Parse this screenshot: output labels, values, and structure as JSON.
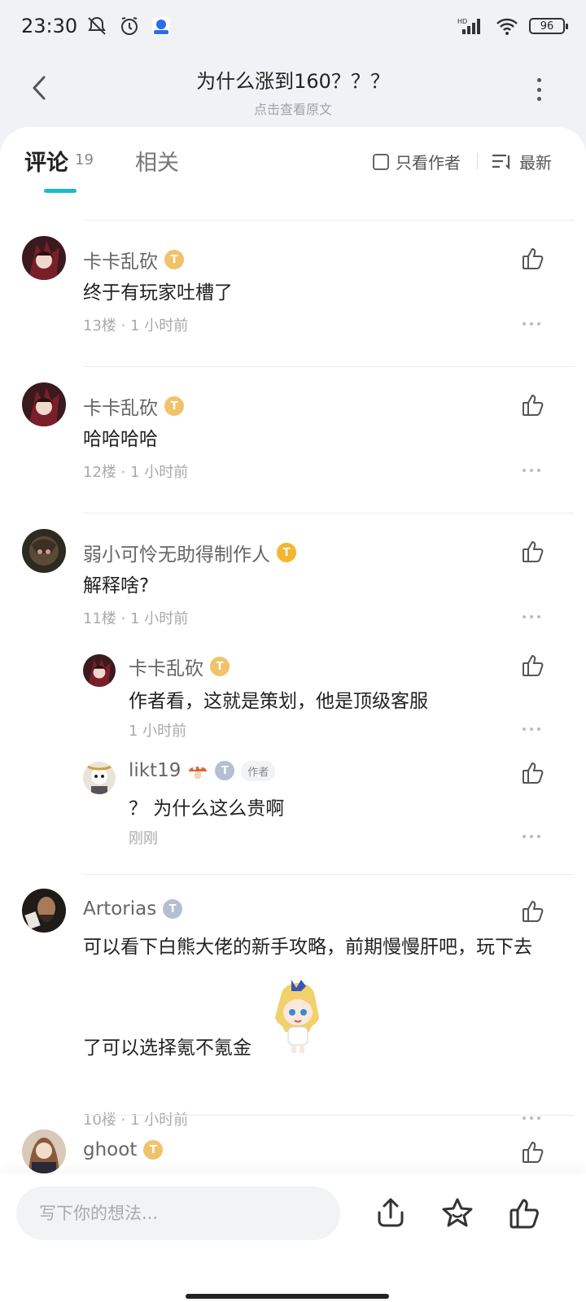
{
  "status_bar": {
    "time": "23:30",
    "battery": "96"
  },
  "header": {
    "title": "为什么涨到160？？？",
    "subtitle": "点击查看原文"
  },
  "tabs": {
    "comments_label": "评论",
    "comments_count": "19",
    "related_label": "相关",
    "only_author_label": "只看作者",
    "sort_label": "最新"
  },
  "comments": [
    {
      "user": "卡卡乱砍",
      "badge": "T",
      "text": "终于有玩家吐槽了",
      "floor": "13楼",
      "time": "1 小时前"
    },
    {
      "user": "卡卡乱砍",
      "badge": "T",
      "text": "哈哈哈哈",
      "floor": "12楼",
      "time": "1 小时前"
    },
    {
      "user": "弱小可怜无助得制作人",
      "badge": "T",
      "text": "解释啥?",
      "floor": "11楼",
      "time": "1 小时前",
      "replies": [
        {
          "user": "卡卡乱砍",
          "badge": "T",
          "text": "作者看，这就是策划，他是顶级客服",
          "time": "1 小时前"
        },
        {
          "user": "likt19",
          "badge": "T",
          "author_tag": "作者",
          "text": "？ 为什么这么贵啊",
          "time": "刚刚"
        }
      ]
    },
    {
      "user": "Artorias",
      "badge": "T",
      "text_line1": "可以看下白熊大佬的新手攻略，前期慢慢肝吧，玩下去",
      "text_line2": "了可以选择氪不氪金",
      "floor": "10楼",
      "time": "1 小时前"
    },
    {
      "user": "ghoot",
      "badge": "T"
    }
  ],
  "bottom_bar": {
    "input_placeholder": "写下你的想法..."
  },
  "colors": {
    "accent": "#1bbbc8",
    "badge_gold": "#f0c36a",
    "badge_silver": "#b5bfd1"
  }
}
